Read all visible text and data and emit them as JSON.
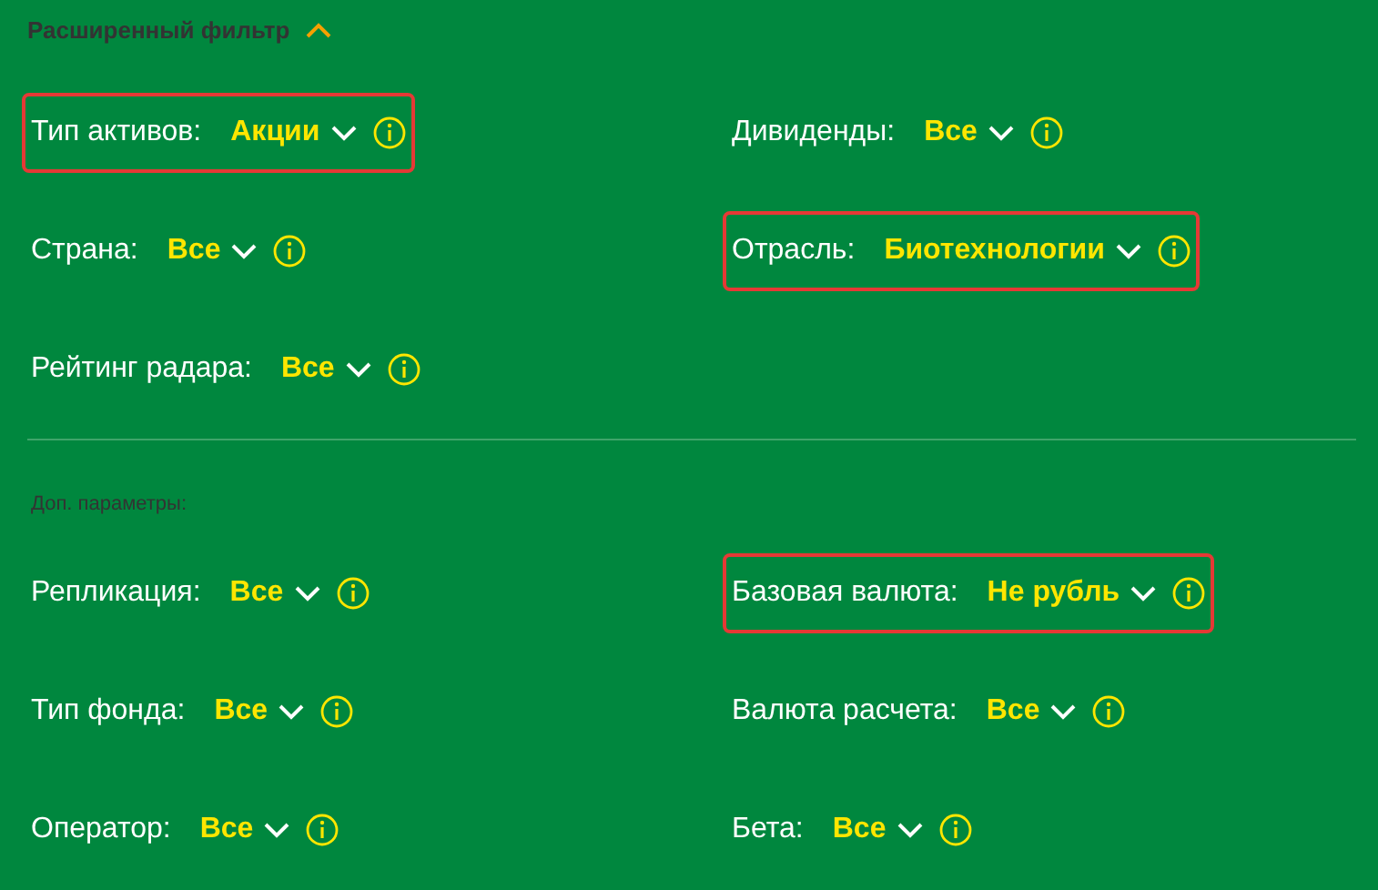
{
  "header": {
    "title": "Расширенный фильтр",
    "expanded": true
  },
  "main_filters": [
    {
      "label": "Тип активов:",
      "value": "Акции",
      "highlighted": true
    },
    {
      "label": "Дивиденды:",
      "value": "Все",
      "highlighted": false
    },
    {
      "label": "Страна:",
      "value": "Все",
      "highlighted": false
    },
    {
      "label": "Отрасль:",
      "value": "Биотехнологии",
      "highlighted": true
    },
    {
      "label": "Рейтинг радара:",
      "value": "Все",
      "highlighted": false
    }
  ],
  "extra_section": {
    "title": "Доп. параметры:"
  },
  "extra_filters": [
    {
      "label": "Репликация:",
      "value": "Все",
      "highlighted": false
    },
    {
      "label": "Базовая валюта:",
      "value": "Не рубль",
      "highlighted": true
    },
    {
      "label": "Тип фонда:",
      "value": "Все",
      "highlighted": false
    },
    {
      "label": "Валюта расчета:",
      "value": "Все",
      "highlighted": false
    },
    {
      "label": "Оператор:",
      "value": "Все",
      "highlighted": false
    },
    {
      "label": "Бета:",
      "value": "Все",
      "highlighted": false
    }
  ]
}
